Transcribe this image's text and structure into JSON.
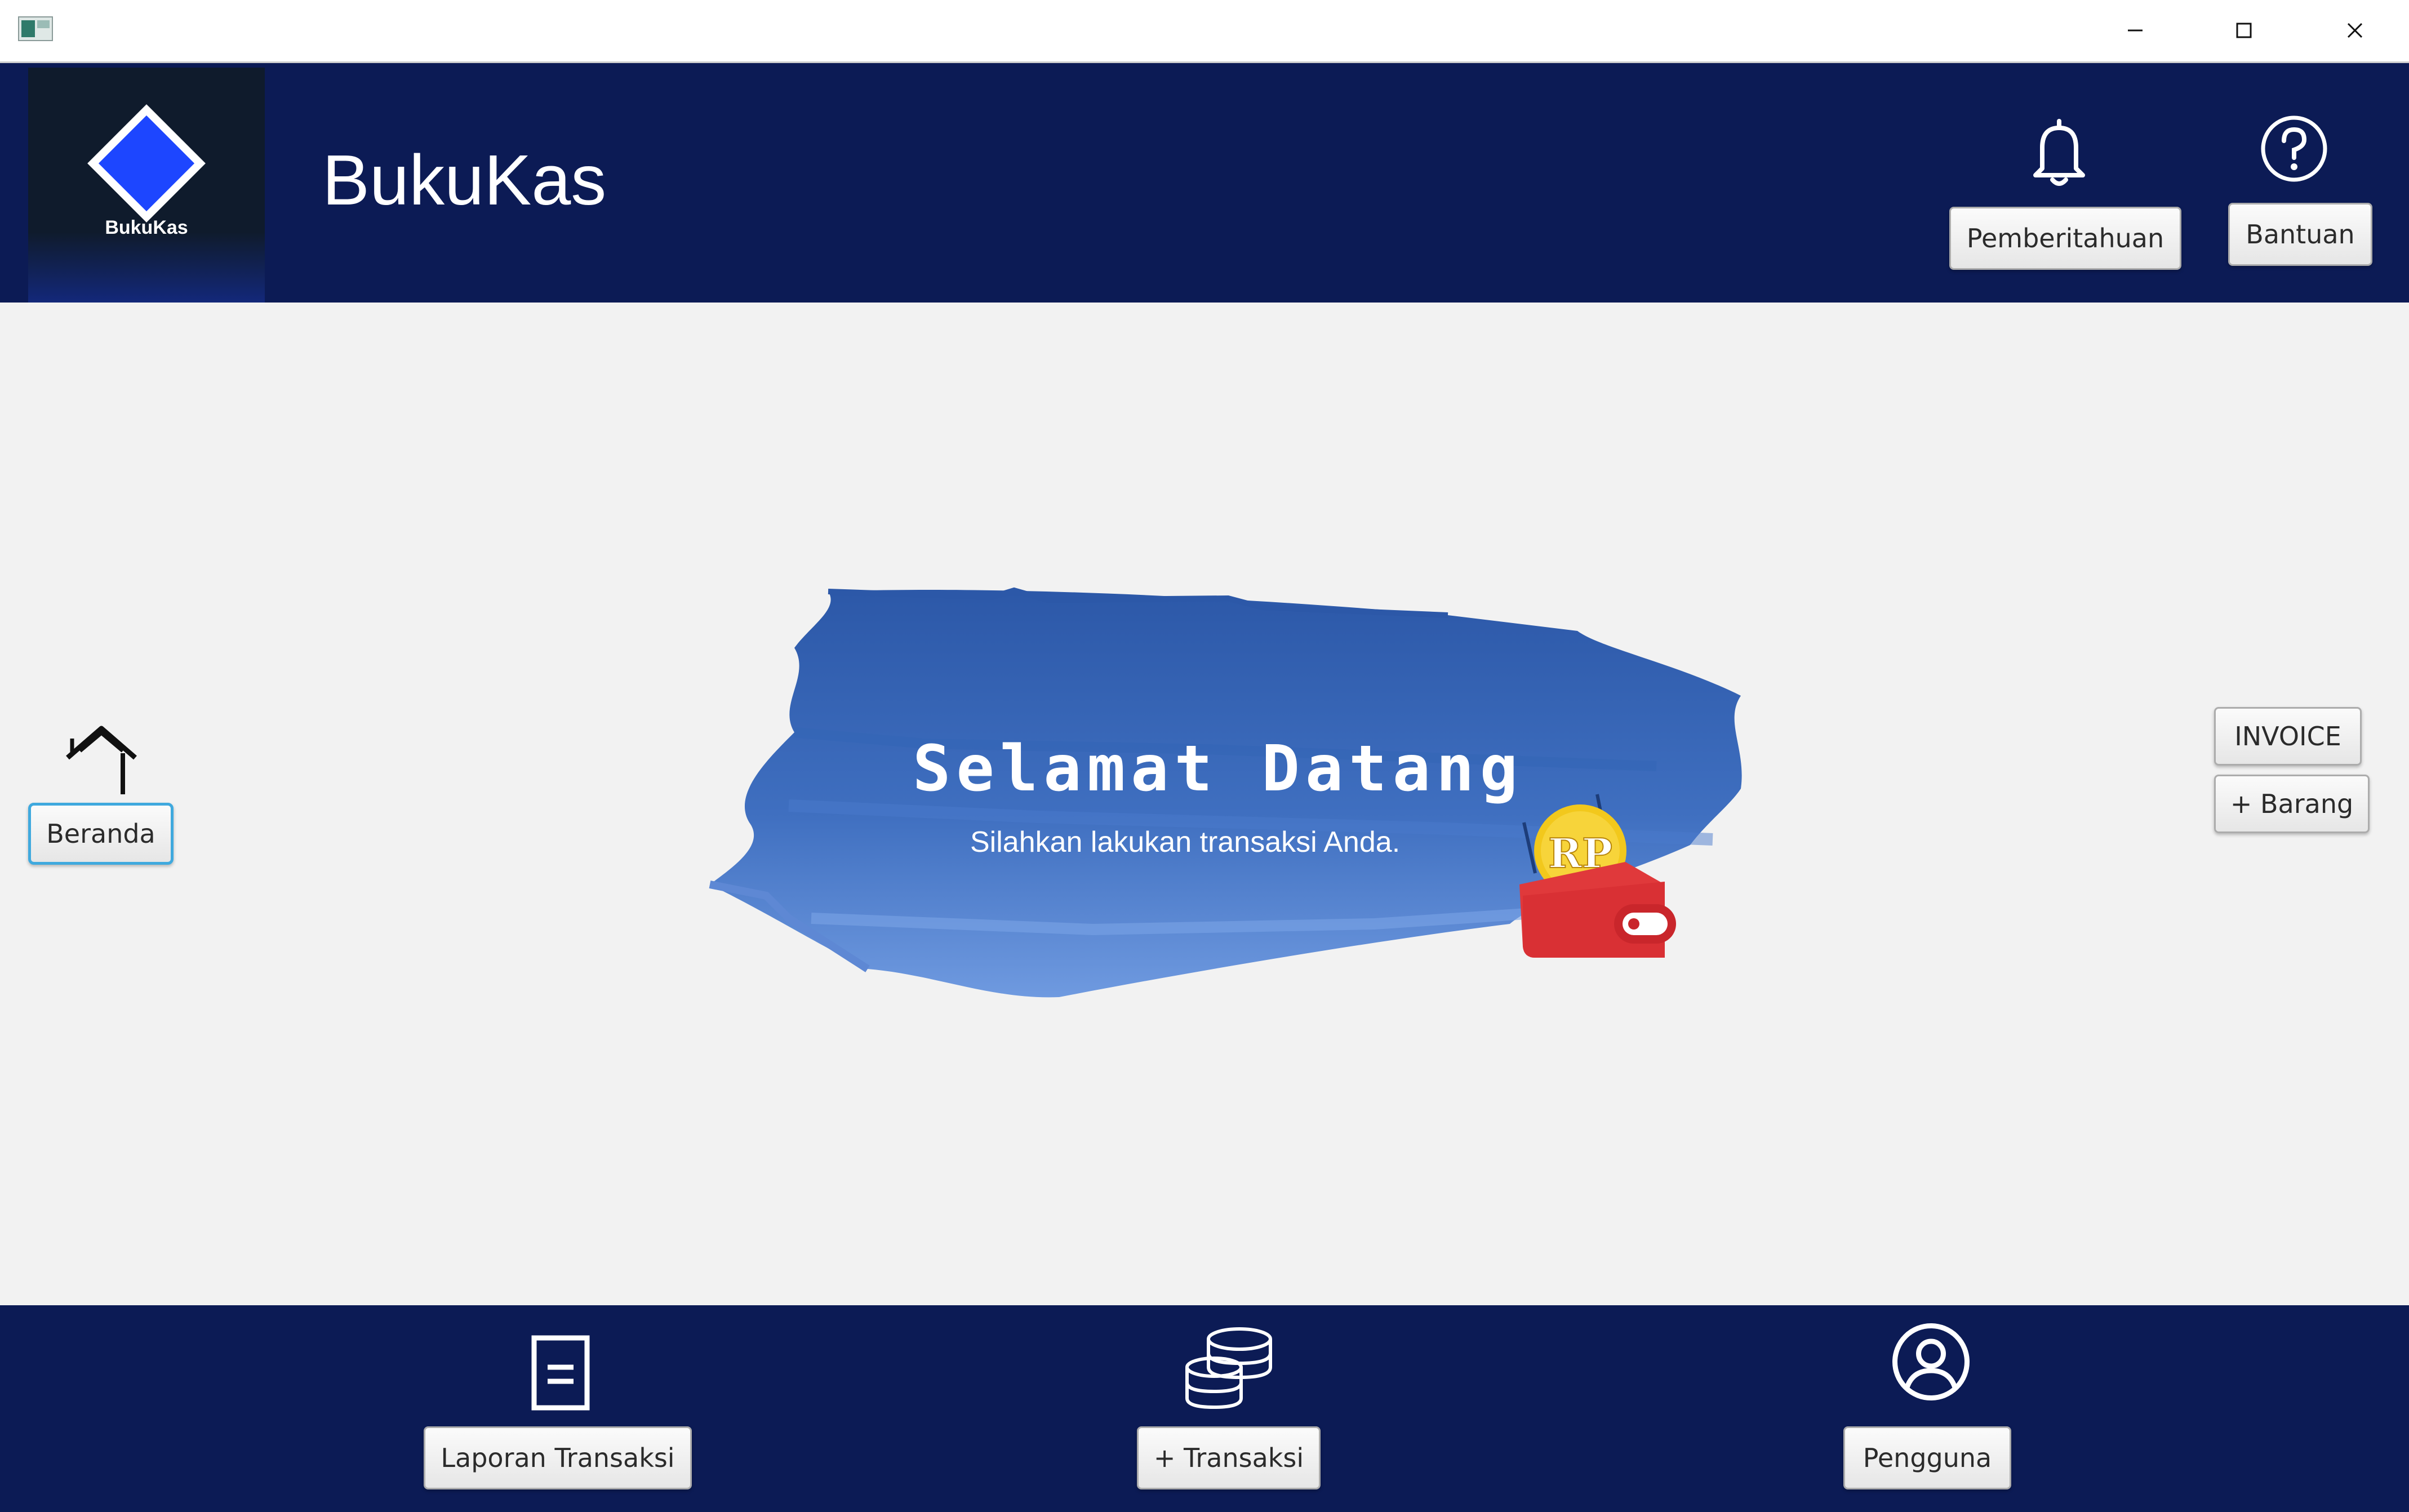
{
  "window": {
    "app_icon": "app-window-icon",
    "controls": {
      "minimize_icon": "minimize-icon",
      "maximize_icon": "maximize-icon",
      "close_icon": "close-icon"
    }
  },
  "header": {
    "logo_text": "BukuKas",
    "app_title": "BukuKas",
    "notification_button": "Pemberitahuan",
    "help_button": "Bantuan",
    "notification_icon": "bell-icon",
    "help_icon": "question-circle-icon",
    "background_color": "#0c1b55"
  },
  "sidebar": {
    "home_label": "Beranda",
    "home_icon": "home-icon"
  },
  "welcome": {
    "title": "Selamat Datang",
    "subtitle": "Silahkan lakukan transaksi Anda.",
    "wallet_coin_text": "RP"
  },
  "right_panel": {
    "invoice_button": "INVOICE",
    "add_item_button": "+ Barang"
  },
  "footer": {
    "report_button": "Laporan Transaksi",
    "add_transaction_button": "+ Transaksi",
    "user_button": "Pengguna",
    "report_icon": "document-icon",
    "transaction_icon": "coins-icon",
    "user_icon": "user-circle-icon"
  },
  "colors": {
    "brand_navy": "#0c1b55",
    "brush_blue": "#3f6fc0",
    "wallet_red": "#e0393b",
    "coin_yellow": "#f2c81c",
    "content_bg": "#f2f2f2",
    "focus_outline": "#3fa9de"
  }
}
